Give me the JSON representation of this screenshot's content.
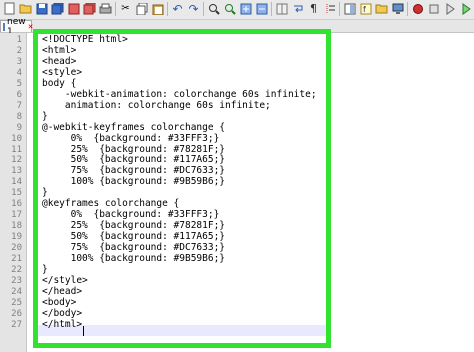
{
  "tab": {
    "label": "new 1",
    "close_glyph": "✕"
  },
  "toolbar": {
    "icons": [
      "new-file-icon",
      "open-folder-icon",
      "save-icon",
      "save-all-icon",
      "close-icon",
      "close-all-icon",
      "print-icon",
      "cut-icon",
      "copy-icon",
      "paste-icon",
      "undo-icon",
      "redo-icon",
      "find-icon",
      "replace-icon",
      "zoom-in-icon",
      "zoom-out-icon",
      "sync-scroll-icon",
      "word-wrap-icon",
      "show-all-chars-icon",
      "indent-guide-icon",
      "doc-map-icon",
      "function-list-icon",
      "folder-workspace-icon",
      "monitor-icon",
      "record-macro-icon",
      "stop-macro-icon",
      "play-macro-icon"
    ]
  },
  "editor": {
    "line_numbers": [
      "1",
      "2",
      "3",
      "4",
      "5",
      "6",
      "7",
      "8",
      "9",
      "10",
      "11",
      "12",
      "13",
      "14",
      "15",
      "16",
      "17",
      "18",
      "19",
      "20",
      "21",
      "22",
      "23",
      "24",
      "25",
      "26",
      "27"
    ],
    "lines": [
      "<!DOCTYPE html>",
      "<html>",
      "<head>",
      "<style>",
      "body {",
      "    -webkit-animation: colorchange 60s infinite;",
      "    animation: colorchange 60s infinite;",
      "}",
      "@-webkit-keyframes colorchange {",
      "     0%  {background: #33FFF3;}",
      "     25%  {background: #78281F;}",
      "     50%  {background: #117A65;}",
      "     75%  {background: #DC7633;}",
      "     100% {background: #9B59B6;}",
      "}",
      "@keyframes colorchange {",
      "     0%  {background: #33FFF3;}",
      "     25%  {background: #78281F;}",
      "     50%  {background: #117A65;}",
      "     75%  {background: #DC7633;}",
      "     100% {background: #9B59B6;}",
      "}",
      "</style>",
      "</head>",
      "<body>",
      "</body>",
      "</html>"
    ]
  },
  "colors": {
    "highlight_border": "#31e231",
    "current_line": "#e8e8ff"
  }
}
